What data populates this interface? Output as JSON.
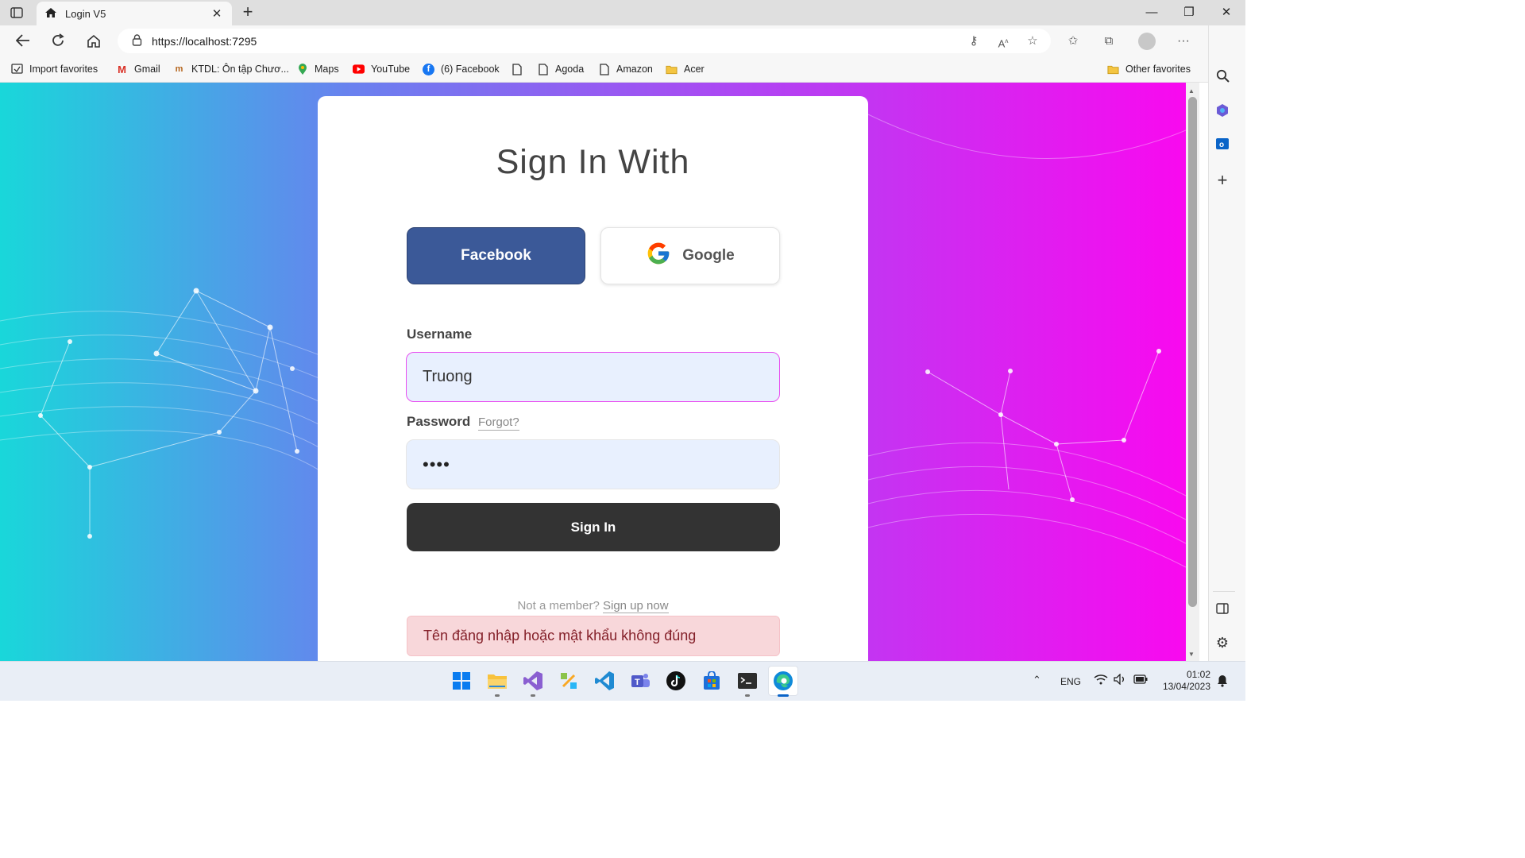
{
  "browser": {
    "tab_title": "Login V5",
    "url": "https://localhost:7295",
    "favorites": [
      {
        "label": "Import favorites",
        "icon": "import-icon"
      },
      {
        "label": "Gmail",
        "icon": "gmail-icon"
      },
      {
        "label": "KTDL: Ôn tập Chươ...",
        "icon": "ktdl-icon"
      },
      {
        "label": "Maps",
        "icon": "maps-icon"
      },
      {
        "label": "YouTube",
        "icon": "youtube-icon"
      },
      {
        "label": "(6) Facebook",
        "icon": "facebook-icon"
      },
      {
        "label": "",
        "icon": "page-icon"
      },
      {
        "label": "Agoda",
        "icon": "page-icon"
      },
      {
        "label": "Amazon",
        "icon": "page-icon"
      },
      {
        "label": "Acer",
        "icon": "folder-icon"
      }
    ],
    "other_favorites": "Other favorites"
  },
  "login": {
    "title": "Sign In With",
    "facebook_label": "Facebook",
    "google_label": "Google",
    "username_label": "Username",
    "username_value": "Truong",
    "password_label": "Password",
    "forgot_label": "Forgot?",
    "password_value": "••••",
    "signin_label": "Sign In",
    "not_member_text": "Not a member?",
    "signup_label": "Sign up now",
    "error_message": "Tên đăng nhập hoặc mật khẩu không đúng"
  },
  "taskbar": {
    "apps": [
      "start-icon",
      "file-explorer-icon",
      "visual-studio-icon",
      "app-icon",
      "vscode-icon",
      "teams-icon",
      "tiktok-icon",
      "store-icon",
      "terminal-icon",
      "edge-icon"
    ],
    "language": "ENG",
    "time": "01:02",
    "date": "13/04/2023"
  },
  "colors": {
    "facebook": "#3b5998",
    "signin": "#333333",
    "error_bg": "#f8d7da",
    "input_focus_border": "#e84ef0"
  }
}
